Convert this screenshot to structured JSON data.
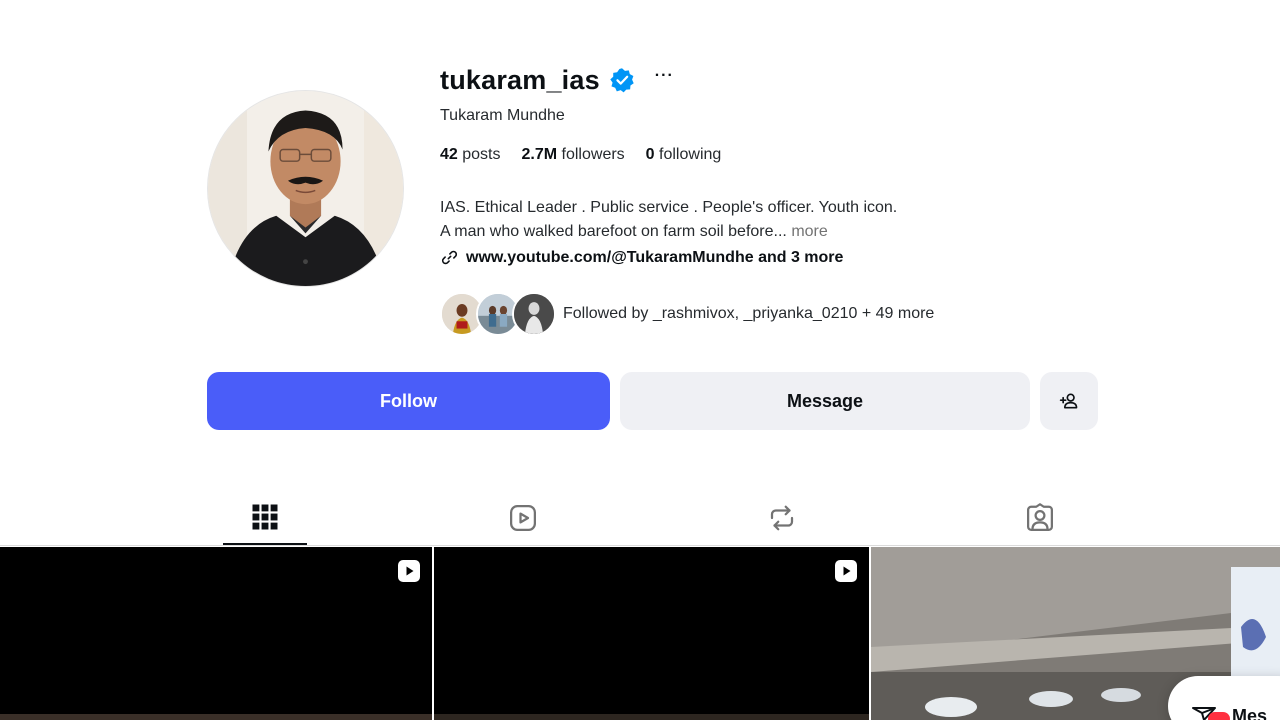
{
  "profile": {
    "username": "tukaram_ias",
    "verified": true,
    "more_options_label": "···",
    "full_name": "Tukaram Mundhe",
    "stats": {
      "posts_count": "42",
      "posts_label": "posts",
      "followers_count": "2.7M",
      "followers_label": "followers",
      "following_count": "0",
      "following_label": "following"
    },
    "bio": {
      "line1": "IAS. Ethical Leader . Public service . People's officer. Youth icon.",
      "line2": "A man who walked barefoot on farm soil before...",
      "more_label": "more"
    },
    "link": {
      "text": "www.youtube.com/@TukaramMundhe and 3 more",
      "icon": "link-icon"
    },
    "followed_by": {
      "text": "Followed by _rashmivox, _priyanka_0210 + 49 more",
      "avatar_count": 3
    }
  },
  "actions": {
    "follow_label": "Follow",
    "message_label": "Message",
    "add_user_icon": "person-add-icon"
  },
  "tabs": [
    {
      "icon": "grid-icon",
      "active": true
    },
    {
      "icon": "reels-icon",
      "active": false
    },
    {
      "icon": "reposts-icon",
      "active": false
    },
    {
      "icon": "tagged-icon",
      "active": false
    }
  ],
  "posts": [
    {
      "type": "reel"
    },
    {
      "type": "reel"
    },
    {
      "type": "image"
    }
  ],
  "messages_widget": {
    "label": "Mes"
  },
  "colors": {
    "accent": "#4a5df9",
    "verified": "#0095f6",
    "secondary_button": "#eff0f4",
    "notification_badge": "#ff3040"
  }
}
